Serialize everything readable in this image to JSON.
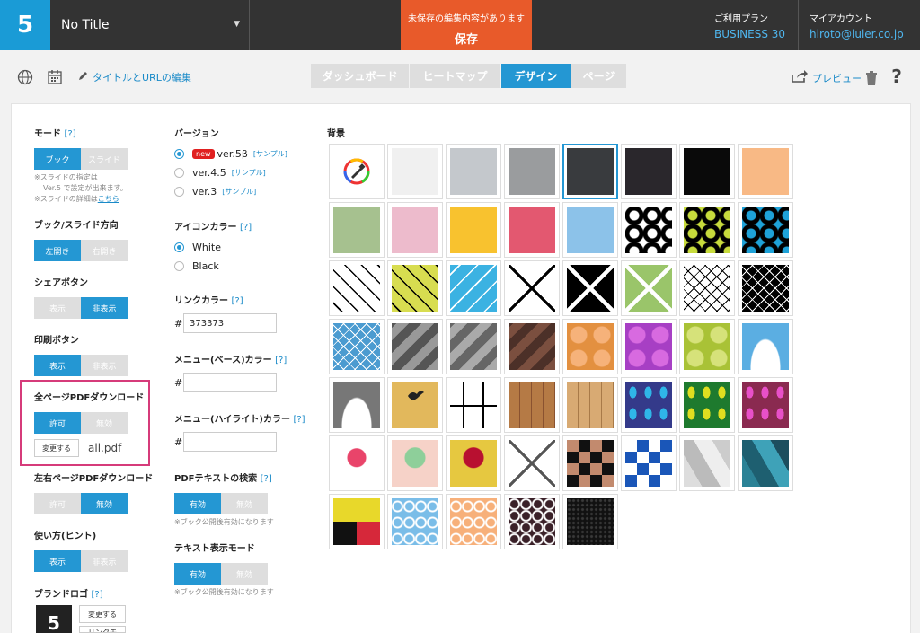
{
  "app": {
    "logo": "5",
    "doc_title": "No Title"
  },
  "save": {
    "note": "未保存の編集内容があります",
    "label": "保存"
  },
  "plan": {
    "label": "ご利用プラン",
    "value": "BUSINESS 30"
  },
  "account": {
    "label": "マイアカウント",
    "value": "hiroto@luler.co.jp"
  },
  "toolbar": {
    "edit_link": "タイトルとURLの編集",
    "preview": "プレビュー",
    "help": "?"
  },
  "tabs": [
    {
      "label": "ダッシュボード",
      "active": false
    },
    {
      "label": "ヒートマップ",
      "active": false
    },
    {
      "label": "デザイン",
      "active": true
    },
    {
      "label": "ページ",
      "active": false
    }
  ],
  "settings": {
    "mode": {
      "label": "モード",
      "help": "[?]",
      "options": [
        "ブック",
        "スライド"
      ],
      "selected": 0,
      "note1": "※スライドの指定は",
      "note2": "Ver.5 で設定が出来ます。",
      "note3": "※スライドの詳細は",
      "note_link": "こちら"
    },
    "direction": {
      "label": "ブック/スライド方向",
      "options": [
        "左開き",
        "右開き"
      ],
      "selected": 0
    },
    "share": {
      "label": "シェアボタン",
      "options": [
        "表示",
        "非表示"
      ],
      "selected": 1
    },
    "print": {
      "label": "印刷ボタン",
      "options": [
        "表示",
        "非表示"
      ],
      "selected": 0
    },
    "all_pdf": {
      "label": "全ページPDFダウンロード",
      "options": [
        "許可",
        "無効"
      ],
      "selected": 0,
      "change": "変更する",
      "filename": "all.pdf"
    },
    "lr_pdf": {
      "label": "左右ページPDFダウンロード",
      "options": [
        "許可",
        "無効"
      ],
      "selected": 1
    },
    "hint": {
      "label": "使い方(ヒント)",
      "options": [
        "表示",
        "非表示"
      ],
      "selected": 0
    },
    "brand": {
      "label": "ブランドロゴ",
      "help": "[?]",
      "logo": "5",
      "change": "変更する",
      "link": "リンク先"
    }
  },
  "version": {
    "label": "バージョン",
    "new_badge": "new",
    "sample": "[サンプル]",
    "items": [
      {
        "label": "ver.5β",
        "selected": true,
        "new": true
      },
      {
        "label": "ver.4.5",
        "selected": false,
        "new": false
      },
      {
        "label": "ver.3",
        "selected": false,
        "new": false
      }
    ]
  },
  "icon_color": {
    "label": "アイコンカラー",
    "help": "[?]",
    "options": [
      "White",
      "Black"
    ],
    "selected": 0
  },
  "link_color": {
    "label": "リンクカラー",
    "help": "[?]",
    "hash": "#",
    "value": "373373"
  },
  "menu_base": {
    "label": "メニュー(ベース)カラー",
    "help": "[?]",
    "hash": "#",
    "value": ""
  },
  "menu_highlight": {
    "label": "メニュー(ハイライト)カラー",
    "help": "[?]",
    "hash": "#",
    "value": ""
  },
  "pdf_search": {
    "label": "PDFテキストの検索",
    "help": "[?]",
    "options": [
      "有効",
      "無効"
    ],
    "selected": 0,
    "note": "※ブック公開後有効になります"
  },
  "text_mode": {
    "label": "テキスト表示モード",
    "options": [
      "有効",
      "無効"
    ],
    "selected": 0,
    "note": "※ブック公開後有効になります"
  },
  "background": {
    "label": "背景",
    "selected_index": 4
  },
  "colors": {
    "accent": "#2497d3",
    "save": "#e85a2a",
    "topbar": "#333333",
    "highlight_box": "#d63b7a"
  }
}
